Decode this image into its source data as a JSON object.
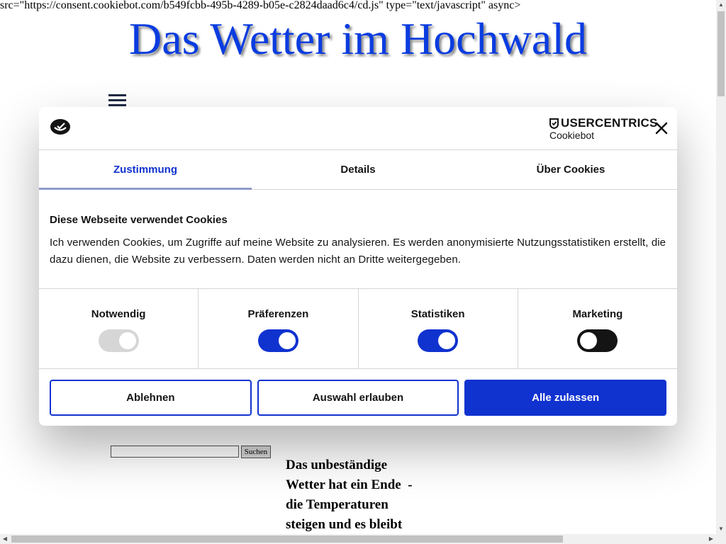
{
  "page": {
    "raw_script_text": "src=\"https://consent.cookiebot.com/b549fcbb-495b-4289-b05e-c2824daad6c4/cd.js\" type=\"text/javascript\" async>",
    "site_title": "Das Wetter im Hochwald",
    "search": {
      "placeholder": "",
      "value": "",
      "button_label": "Suchen"
    },
    "article_text": "Das unbeständige Wetter hat ein Ende  - die Temperaturen steigen und es bleibt"
  },
  "cookie_dialog": {
    "brand_top": "USERCENTRICS",
    "brand_bottom": "Cookiebot",
    "close_icon": "close-icon",
    "tabs": [
      {
        "label": "Zustimmung",
        "active": true
      },
      {
        "label": "Details",
        "active": false
      },
      {
        "label": "Über Cookies",
        "active": false
      }
    ],
    "heading": "Diese Webseite verwendet Cookies",
    "body": "Ich verwenden Cookies, um Zugriffe auf meine Website zu analysieren. Es werden anonymisierte Nutzungsstatistiken erstellt, die dazu dienen, die Website zu verbessern. Daten werden nicht an Dritte weitergegeben.",
    "categories": [
      {
        "label": "Notwendig",
        "state": "on",
        "disabled": true
      },
      {
        "label": "Präferenzen",
        "state": "on",
        "disabled": false
      },
      {
        "label": "Statistiken",
        "state": "on",
        "disabled": false
      },
      {
        "label": "Marketing",
        "state": "off",
        "disabled": false
      }
    ],
    "buttons": {
      "reject": "Ablehnen",
      "allow_selection": "Auswahl erlauben",
      "allow_all": "Alle zulassen"
    }
  },
  "colors": {
    "title_blue": "#0a3ce0",
    "accent_blue": "#1032cf",
    "toggle_off_dark": "#141414",
    "toggle_disabled": "#d6d6d6"
  }
}
